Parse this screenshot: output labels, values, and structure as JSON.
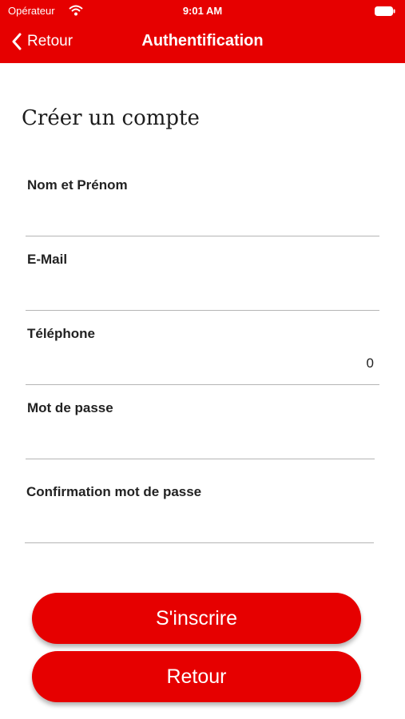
{
  "status_bar": {
    "carrier": "Opérateur",
    "time": "9:01 AM"
  },
  "nav": {
    "back_label": "Retour",
    "title": "Authentification"
  },
  "page": {
    "title": "Créer un compte"
  },
  "form": {
    "name": {
      "label": "Nom et Prénom",
      "value": ""
    },
    "email": {
      "label": "E-Mail",
      "value": ""
    },
    "phone": {
      "label": "Téléphone",
      "value": "0"
    },
    "password": {
      "label": "Mot de passe",
      "value": ""
    },
    "password_confirm": {
      "label": "Confirmation mot de passe",
      "value": ""
    }
  },
  "buttons": {
    "register": "S'inscrire",
    "back": "Retour"
  },
  "colors": {
    "accent": "#e60000"
  },
  "icons": {
    "wifi": "wifi-icon",
    "battery": "battery-icon",
    "back": "chevron-left-icon"
  }
}
